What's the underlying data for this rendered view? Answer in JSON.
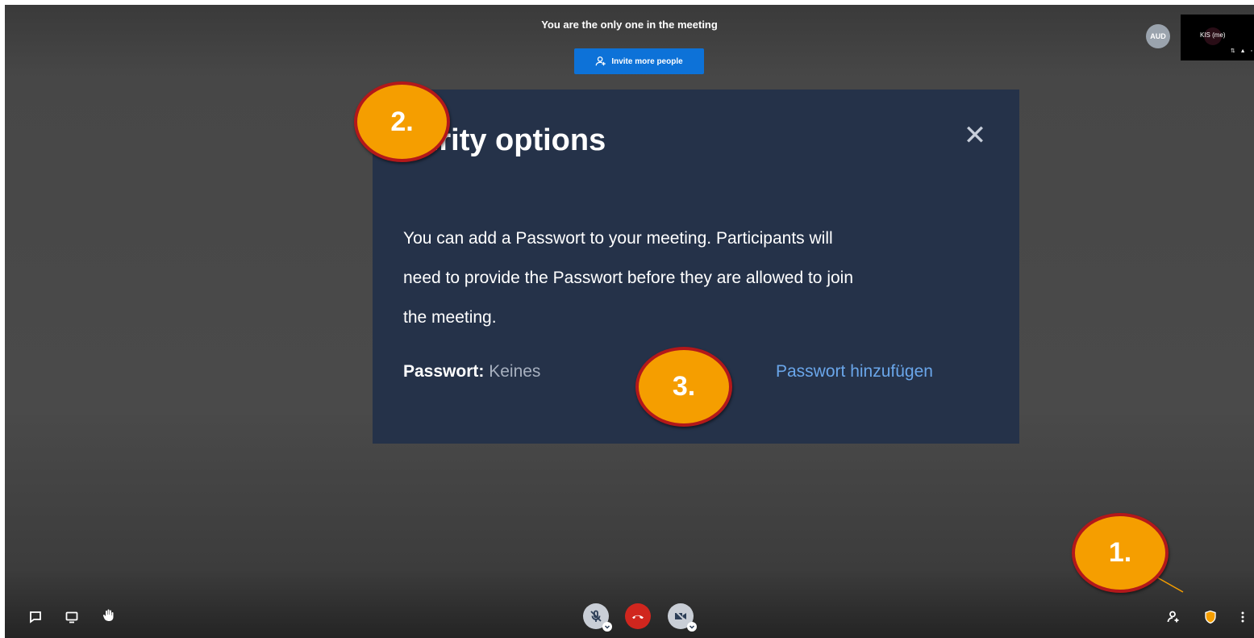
{
  "top": {
    "notice": "You are the only one in the meeting",
    "invite_button": "Invite more people"
  },
  "filmstrip": {
    "avatar_initials": "AUD",
    "self_name": "KIS (me)"
  },
  "dialog": {
    "title": "Security options",
    "title_visible": "curity options",
    "body": "You can add a Passwort to your meeting. Participants will need to provide the Passwort before they are allowed to join the meeting.",
    "body_line1": "You can add a Passwort to your meeting. Participants will",
    "body_line2": "need to provide the Passwort before they are allowed to join",
    "body_line3": "the meeting.",
    "password_label": "Passwort:",
    "password_value": "Keines",
    "add_password_link": "Passwort hinzufügen"
  },
  "annotations": {
    "step1": "1.",
    "step2": "2.",
    "step3": "3."
  },
  "toolbar": {
    "left": [
      "chat-icon",
      "screen-share-icon",
      "raise-hand-icon"
    ],
    "center": [
      "microphone-muted-icon",
      "hangup-icon",
      "camera-off-icon"
    ],
    "right": [
      "invite-people-icon",
      "security-shield-icon",
      "more-options-icon"
    ]
  },
  "colors": {
    "stage_background": "#474747",
    "dialog_background": "#253249",
    "invite_button": "#0d72d8",
    "link": "#6aa6ea",
    "hangup": "#d0261e",
    "badge_fill": "#f59e00",
    "badge_border": "#b3181a",
    "shield": "#f59e00"
  }
}
